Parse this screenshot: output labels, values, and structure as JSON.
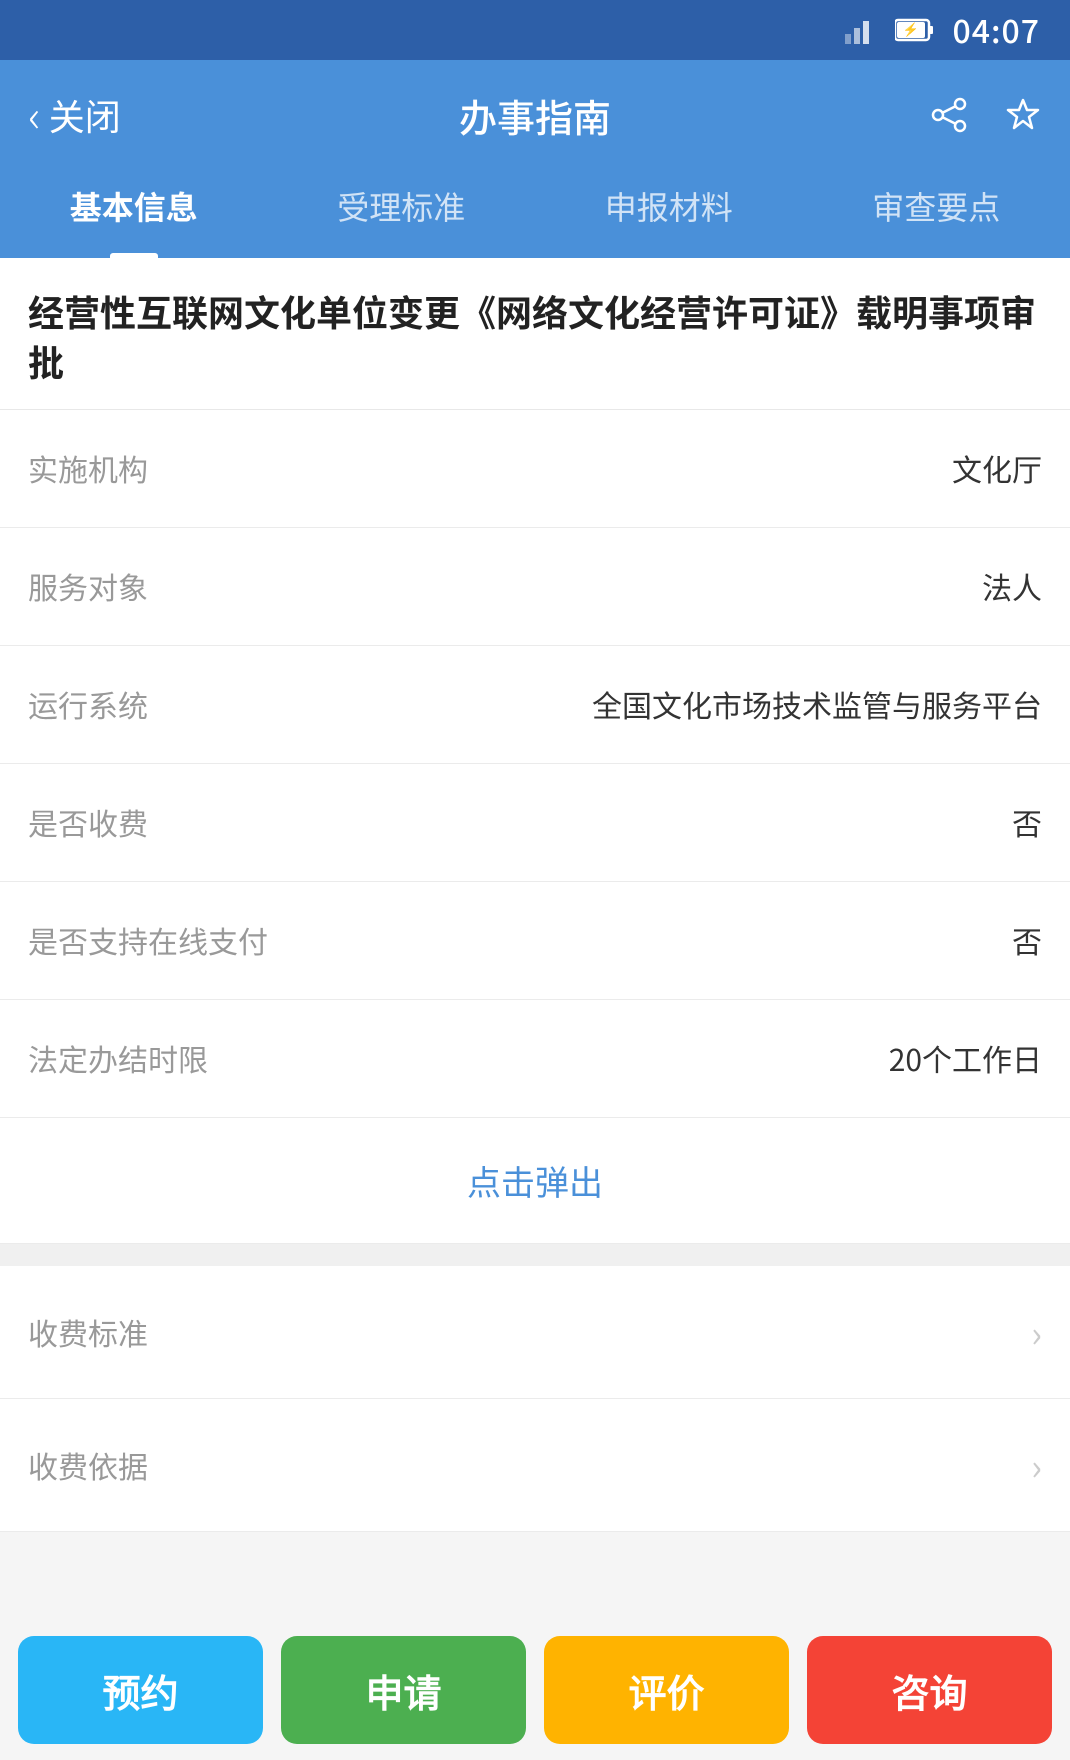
{
  "statusBar": {
    "time": "04:07"
  },
  "navBar": {
    "backLabel": "关闭",
    "title": "办事指南"
  },
  "tabs": [
    {
      "id": "basic",
      "label": "基本信息",
      "active": true
    },
    {
      "id": "standard",
      "label": "受理标准",
      "active": false
    },
    {
      "id": "materials",
      "label": "申报材料",
      "active": false
    },
    {
      "id": "review",
      "label": "审查要点",
      "active": false
    }
  ],
  "pageTitle": "经营性互联网文化单位变更《网络文化经营许可证》载明事项审批",
  "infoRows": [
    {
      "label": "实施机构",
      "value": "文化厅"
    },
    {
      "label": "服务对象",
      "value": "法人"
    },
    {
      "label": "运行系统",
      "value": "全国文化市场技术监管与服务平台"
    },
    {
      "label": "是否收费",
      "value": "否"
    },
    {
      "label": "是否支持在线支付",
      "value": "否"
    },
    {
      "label": "法定办结时限",
      "value": "20个工作日"
    }
  ],
  "clickLink": "点击弹出",
  "listRows": [
    {
      "label": "收费标准"
    },
    {
      "label": "收费依据"
    }
  ],
  "actionButtons": [
    {
      "id": "reserve",
      "label": "预约",
      "colorClass": "btn-blue"
    },
    {
      "id": "apply",
      "label": "申请",
      "colorClass": "btn-green"
    },
    {
      "id": "rate",
      "label": "评价",
      "colorClass": "btn-orange"
    },
    {
      "id": "consult",
      "label": "咨询",
      "colorClass": "btn-red"
    }
  ]
}
